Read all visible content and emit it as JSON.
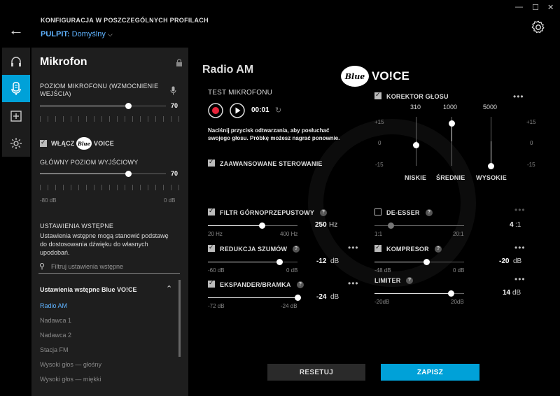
{
  "window": {
    "minimize": "—",
    "maximize": "☐",
    "close": "✕"
  },
  "header": {
    "title": "KONFIGURACJA W POSZCZEGÓLNYCH PROFILACH",
    "profile_label": "PULPIT:",
    "profile_value": "Domyślny"
  },
  "panel": {
    "title": "Mikrofon",
    "mic_level_label": "POZIOM MIKROFONU (WZMOCNIENIE WEJŚCIA)",
    "mic_level_value": "70",
    "mic_level_fraction": 0.7,
    "enable_label": "WŁĄCZ",
    "enable_logo_text": "Blue",
    "enable_voice": "VOICE",
    "output_label": "GŁÓWNY POZIOM WYJŚCIOWY",
    "output_value": "70",
    "output_fraction": 0.7,
    "output_min": "-80 dB",
    "output_max": "0 dB",
    "presets_heading": "USTAWIENIA WSTĘPNE",
    "presets_desc": "Ustawienia wstępne mogą stanowić podstawę do dostosowania dźwięku do własnych upodobań.",
    "search_placeholder": "Filtruj ustawienia wstępne",
    "group_label": "Ustawienia wstępne Blue VO!CE",
    "presets": [
      "Radio AM",
      "Nadawca 1",
      "Nadawca 2",
      "Stacja FM",
      "Wysoki głos — głośny",
      "Wysoki głos — miękki"
    ],
    "active_preset": "Radio AM"
  },
  "main": {
    "title": "Radio AM",
    "brand_logo": "Blue",
    "brand_text": "VO!CE",
    "test": {
      "label": "TEST MIKROFONU",
      "time": "00:01",
      "instructions": "Naciśnij przycisk odtwarzania, aby posłuchać swojego głosu. Próbkę możesz nagrać ponownie."
    },
    "advanced_label": "ZAAWANSOWANE STEROWANIE",
    "eq": {
      "label": "KOREKTOR GŁOSU",
      "freqs": [
        "310",
        "1000",
        "5000"
      ],
      "bands": [
        "NISKIE",
        "ŚREDNIE",
        "WYSOKIE"
      ],
      "scale": [
        "+15",
        "0",
        "-15"
      ],
      "gains_db": [
        -2,
        11,
        -15
      ]
    },
    "hpf": {
      "label": "FILTR GÓRNOPRZEPUSTOWY",
      "value": "250",
      "unit": "Hz",
      "min": "20 Hz",
      "max": "400 Hz",
      "fraction": 0.6
    },
    "noise": {
      "label": "REDUKCJA SZUMÓW",
      "value": "-12",
      "unit": "dB",
      "min": "-60 dB",
      "max": "0 dB",
      "fraction": 0.8
    },
    "expander": {
      "label": "EKSPANDER/BRAMKA",
      "value": "-24",
      "unit": "dB",
      "min": "-72 dB",
      "max": "-24 dB",
      "fraction": 1.0
    },
    "deesser": {
      "label": "DE-ESSER",
      "value": "4",
      "unit": ":1",
      "min": "1:1",
      "max": "20:1",
      "fraction": 0.18
    },
    "compressor": {
      "label": "KOMPRESOR",
      "value": "-20",
      "unit": "dB",
      "min": "-48 dB",
      "max": "0 dB",
      "fraction": 0.58
    },
    "limiter": {
      "label": "LIMITER",
      "value": "14",
      "unit": "dB",
      "min": "-20dB",
      "max": "20dB",
      "fraction": 0.85
    },
    "more": "•••",
    "help": "?",
    "reset_label": "RESETUJ",
    "save_label": "ZAPISZ"
  },
  "colors": {
    "accent": "#00a1d8",
    "link": "#5fb3ff",
    "panel": "#1e1e1e",
    "record": "#e8243b"
  }
}
